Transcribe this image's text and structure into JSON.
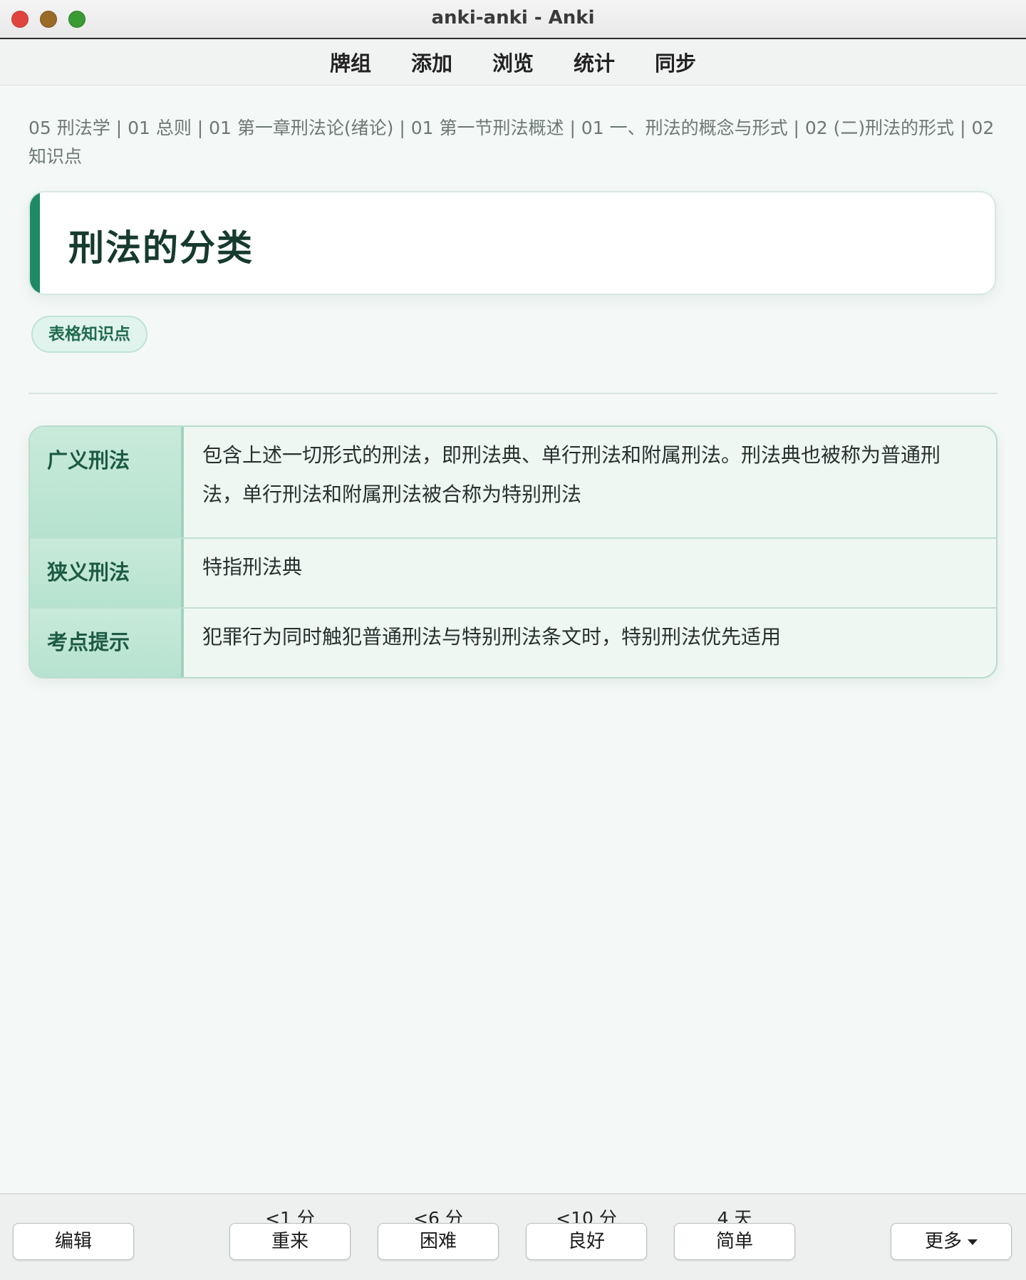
{
  "window": {
    "title": "anki-anki - Anki"
  },
  "top_nav": {
    "items": [
      "牌组",
      "添加",
      "浏览",
      "统计",
      "同步"
    ]
  },
  "card": {
    "breadcrumb": "05 刑法学 | 01 总则 | 01 第一章刑法论(绪论) | 01 第一节刑法概述 | 01 一、刑法的概念与形式 | 02 (二)刑法的形式 | 02 知识点",
    "title": "刑法的分类",
    "tag": "表格知识点",
    "table": [
      {
        "head": "广义刑法",
        "body": "包含上述一切形式的刑法，即刑法典、单行刑法和附属刑法。刑法典也被称为普通刑法，单行刑法和附属刑法被合称为特别刑法"
      },
      {
        "head": "狭义刑法",
        "body": "特指刑法典"
      },
      {
        "head": "考点提示",
        "body": "犯罪行为同时触犯普通刑法与特别刑法条文时，特别刑法优先适用"
      }
    ]
  },
  "bottom_bar": {
    "edit_label": "编辑",
    "more_label": "更多",
    "answers": [
      {
        "due": "<1 分",
        "label": "重来"
      },
      {
        "due": "<6 分",
        "label": "困难"
      },
      {
        "due": "<10 分",
        "label": "良好"
      },
      {
        "due": "4 天",
        "label": "简单"
      }
    ]
  },
  "colors": {
    "accent": "#1f8a66",
    "table_header_bg": "#c8eadb",
    "page_bg": "#f4f8f6"
  }
}
